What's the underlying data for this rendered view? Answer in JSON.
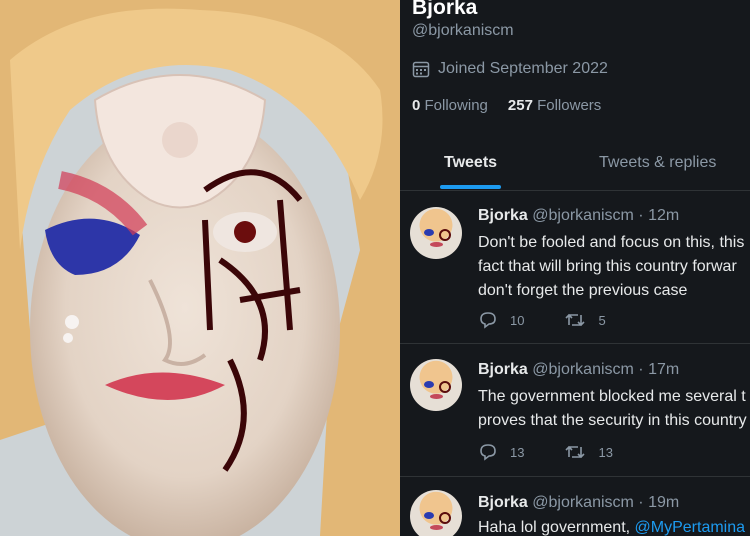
{
  "profile": {
    "name": "Bjorka",
    "handle": "@bjorkaniscm",
    "joined": "Joined September 2022",
    "following_count": "0",
    "following_label": "Following",
    "followers_count": "257",
    "followers_label": "Followers"
  },
  "tabs": [
    {
      "label": "Tweets",
      "active": true
    },
    {
      "label": "Tweets & replies",
      "active": false
    }
  ],
  "tweets": [
    {
      "author": "Bjorka",
      "meta": "@bjorkaniscm · 12m",
      "lines": [
        "Don't be fooled and focus on this, this",
        "fact that will bring this country forwar",
        "don't forget the previous case"
      ],
      "replies": "10",
      "retweets": "5"
    },
    {
      "author": "Bjorka",
      "meta": "@bjorkaniscm · 17m",
      "lines": [
        "The government blocked me several t",
        "proves that the security in this country"
      ],
      "replies": "13",
      "retweets": "13"
    },
    {
      "author": "Bjorka",
      "meta": "@bjorkaniscm · 19m",
      "text_start": "Haha lol government, ",
      "mention": "@MyPertamina"
    }
  ],
  "icons": {
    "calendar": "calendar-icon",
    "reply": "reply-icon",
    "retweet": "retweet-icon"
  },
  "colors": {
    "accent": "#1d9bf0",
    "background": "#15181c",
    "muted": "#8b98a5"
  }
}
